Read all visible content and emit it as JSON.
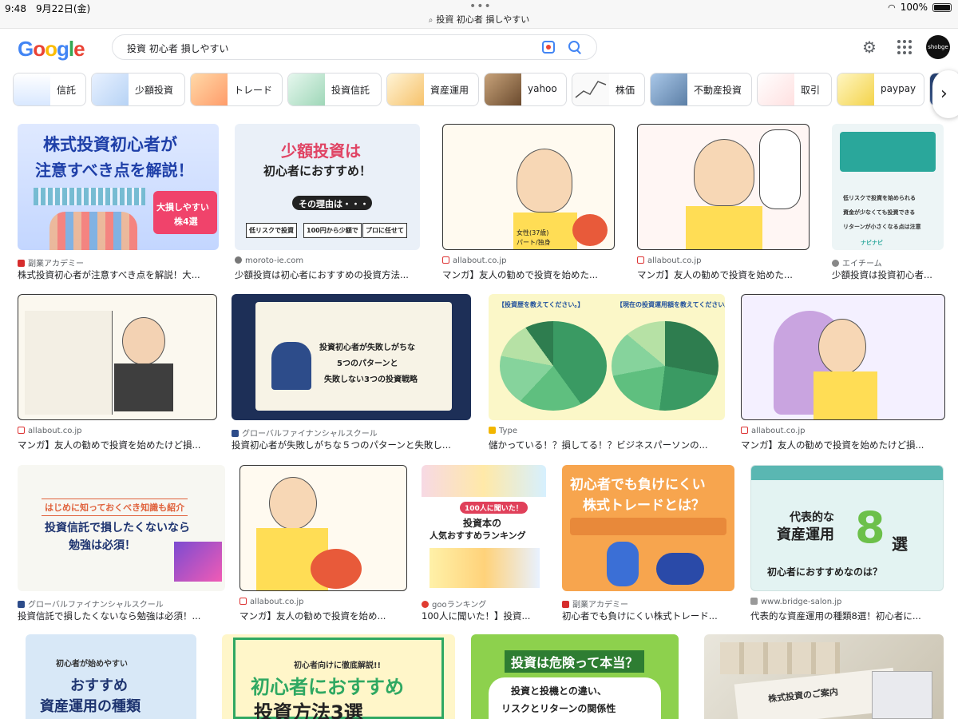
{
  "status": {
    "time": "9:48",
    "date": "9月22日(金)",
    "url": "投資 初心者 損しやすい",
    "battery": "100%"
  },
  "header": {
    "logo": [
      "G",
      "o",
      "o",
      "g",
      "l",
      "e"
    ],
    "query": "投資 初心者 損しやすい",
    "avatar_text": "shobge"
  },
  "colors": {
    "google_blue": "#4285f4",
    "google_red": "#ea4335",
    "google_yellow": "#fbbc05",
    "google_green": "#34a853"
  },
  "chips": [
    {
      "label": "信託"
    },
    {
      "label": "少額投資"
    },
    {
      "label": "トレード"
    },
    {
      "label": "投資信託"
    },
    {
      "label": "資産運用"
    },
    {
      "label": "yahoo"
    },
    {
      "label": "株価"
    },
    {
      "label": "不動産投資"
    },
    {
      "label": "取引"
    },
    {
      "label": "paypay"
    }
  ],
  "results": [
    {
      "source": "副業アカデミー",
      "title": "株式投資初心者が注意すべき点を解説！大...",
      "banner": [
        "株式投資初心者が",
        "注意すべき点を解説！",
        "大損しやすい",
        "株4選"
      ]
    },
    {
      "source": "moroto-ie.com",
      "title": "少額投資は初心者におすすめの投資方法...",
      "banner": [
        "少額投資は",
        "初心者におすすめ！",
        "その理由は・・・",
        "低リスクで投資",
        "100円から少額で",
        "プロに任せて"
      ]
    },
    {
      "source": "allabout.co.jp",
      "title": "マンガ】友人の勧めで投資を始めた...",
      "banner": [
        "女性(37歳)",
        "パート/独身"
      ]
    },
    {
      "source": "allabout.co.jp",
      "title": "マンガ】友人の勧めで投資を始めた...",
      "banner": []
    },
    {
      "source": "エイチーム",
      "title": "少額投資は投資初心者...",
      "banner": [
        "低リスクで投資を始められる",
        "資金が少なくても投資できる",
        "リターンが小さくなる点は注意",
        "ナビナビ"
      ]
    },
    {
      "source": "allabout.co.jp",
      "title": "マンガ】友人の勧めで投資を始めたけど損...",
      "banner": []
    },
    {
      "source": "グローバルファイナンシャルスクール",
      "title": "投資初心者が失敗しがちな５つのパターンと失敗し...",
      "banner": [
        "投資初心者が失敗しがちな",
        "5つのパターンと",
        "失敗しない3つの投資戦略"
      ]
    },
    {
      "source": "Type",
      "title": "儲かっている！？損してる！？ビジネスパーソンの...",
      "banner": [
        "【投資歴を教えてください。】",
        "【現在の投資運用額を教えてください。】"
      ]
    },
    {
      "source": "allabout.co.jp",
      "title": "マンガ】友人の勧めで投資を始めたけど損...",
      "banner": []
    },
    {
      "source": "グローバルファイナンシャルスクール",
      "title": "投資信託で損したくないなら勉強は必須！...",
      "banner": [
        "はじめに知っておくべき知識も紹介",
        "投資信託で損したくないなら",
        "勉強は必須！"
      ]
    },
    {
      "source": "allabout.co.jp",
      "title": "マンガ】友人の勧めで投資を始め...",
      "banner": []
    },
    {
      "source": "gooランキング",
      "title": "100人に聞いた！】投資...",
      "banner": [
        "100人に聞いた！",
        "投資本の",
        "人気おすすめランキング"
      ]
    },
    {
      "source": "副業アカデミー",
      "title": "初心者でも負けにくい株式トレード...",
      "banner": [
        "初心者でも負けにくい",
        "株式トレードとは？"
      ]
    },
    {
      "source": "www.bridge-salon.jp",
      "title": "代表的な資産運用の種類8選！初心者に...",
      "banner": [
        "代表的な",
        "資産運用",
        "8",
        "選",
        "初心者におすすめなのは？"
      ]
    },
    {
      "source": "",
      "title": "",
      "banner": [
        "初心者が始めやすい",
        "おすすめ",
        "資産運用の種類"
      ]
    },
    {
      "source": "",
      "title": "",
      "banner": [
        "初心者向けに徹底解説!!",
        "初心者におすすめ",
        "投資方法3選"
      ]
    },
    {
      "source": "",
      "title": "",
      "banner": [
        "投資は危険って本当？",
        "投資と投機との違い、",
        "リスクとリターンの関係性"
      ]
    },
    {
      "source": "",
      "title": "",
      "banner": [
        "株式投資のご案内"
      ]
    }
  ]
}
